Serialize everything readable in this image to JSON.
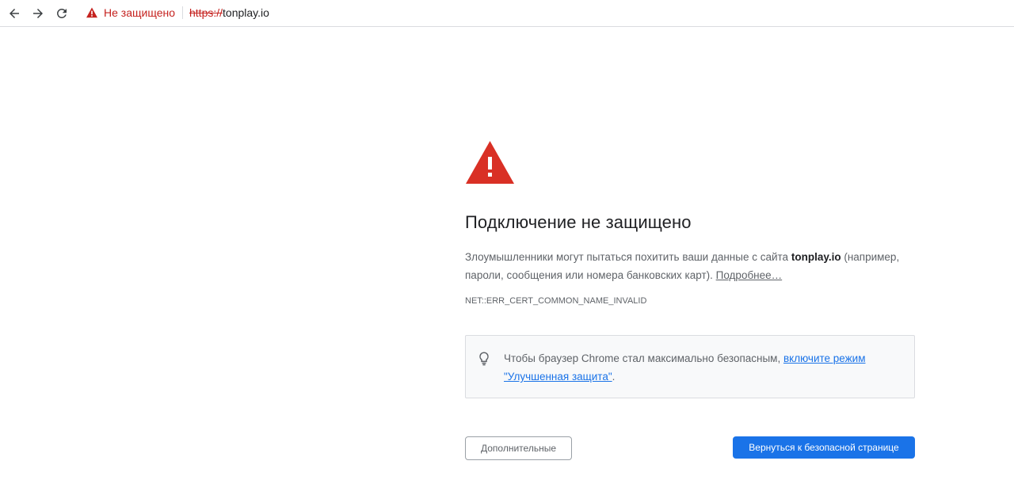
{
  "toolbar": {
    "security_label": "Не защищено",
    "url_scheme": "https://",
    "url_host": "tonplay.io",
    "icons": [
      "back-arrow-icon",
      "forward-arrow-icon",
      "reload-icon",
      "warning-triangle-icon"
    ]
  },
  "interstitial": {
    "heading": "Подключение не защищено",
    "explanation_prefix": "Злоумышленники могут пытаться похитить ваши данные с сайта ",
    "site_name": "tonplay.io",
    "explanation_suffix": " (например, пароли, сообщения или номера банковских карт). ",
    "learn_more": "Подробнее…",
    "error_code": "NET::ERR_CERT_COMMON_NAME_INVALID",
    "enhanced_prefix": "Чтобы браузер Chrome стал максимально безопасным, ",
    "enhanced_link": "включите режим \"Улучшенная защита\"",
    "enhanced_suffix": ".",
    "details_button": "Дополнительные",
    "back_button": "Вернуться к безопасной странице"
  },
  "colors": {
    "warning_red": "#d93025",
    "link_blue": "#1a73e8",
    "primary_button": "#1a73e8",
    "text_secondary": "#5f6368"
  }
}
